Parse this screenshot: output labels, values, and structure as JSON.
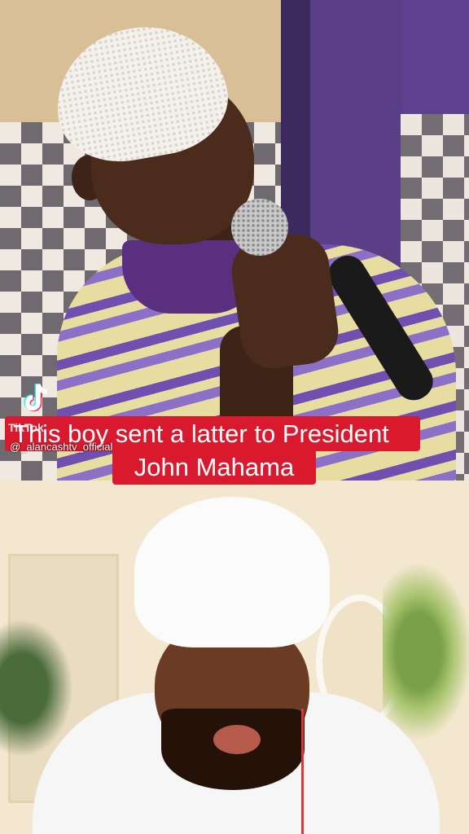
{
  "watermark": {
    "brand": "TikTok",
    "handle": "@_alancashtv_official"
  },
  "caption": {
    "line1": "This boy sent a latter to President",
    "line2": "John Mahama"
  },
  "colors": {
    "caption_bg": "#d8192e",
    "caption_text": "#ffffff"
  },
  "icons": {
    "watermark_logo": "tiktok-logo-icon"
  }
}
